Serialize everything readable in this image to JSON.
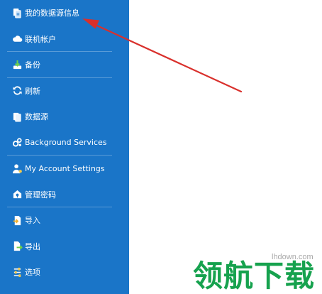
{
  "sidebar": {
    "accent_color": "#1a75c8",
    "items": [
      {
        "label": "我的数据源信息",
        "icon": "database-info-icon"
      },
      {
        "label": "联机帐户",
        "icon": "cloud-icon"
      },
      {
        "label": "备份",
        "icon": "backup-download-icon"
      },
      {
        "label": "刷新",
        "icon": "refresh-icon"
      },
      {
        "label": "数据源",
        "icon": "data-source-icon"
      },
      {
        "label": "Background Services",
        "icon": "gears-icon"
      },
      {
        "label": "My Account Settings",
        "icon": "user-settings-icon"
      },
      {
        "label": "管理密码",
        "icon": "password-icon"
      },
      {
        "label": "导入",
        "icon": "import-icon"
      },
      {
        "label": "导出",
        "icon": "export-icon"
      },
      {
        "label": "选项",
        "icon": "options-icon"
      }
    ]
  },
  "annotation": {
    "arrow_color": "#d9302c"
  },
  "watermark": {
    "url": "lhdown.com",
    "brand": "领航下载",
    "brand_color": "#16a24e"
  }
}
